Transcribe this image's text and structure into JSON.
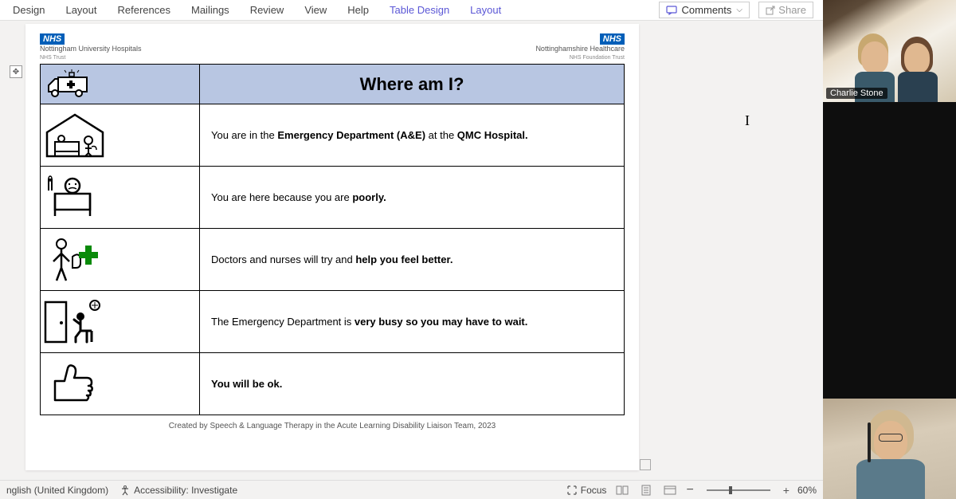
{
  "ribbon": {
    "tabs": [
      "Design",
      "Layout",
      "References",
      "Mailings",
      "Review",
      "View",
      "Help",
      "Table Design",
      "Layout"
    ],
    "active_indexes": [
      7,
      8
    ],
    "comments_label": "Comments",
    "share_label": "Share"
  },
  "doc": {
    "header_left_org": "Nottingham University Hospitals",
    "header_left_sub": "NHS Trust",
    "header_right_org": "Nottinghamshire Healthcare",
    "header_right_sub": "NHS Foundation Trust",
    "nhs_badge": "NHS",
    "title": "Where am I?",
    "rows": [
      {
        "segments": [
          {
            "t": "You are in the ",
            "b": false
          },
          {
            "t": "Emergency Department (A&E)",
            "b": true
          },
          {
            "t": " at the ",
            "b": false
          },
          {
            "t": "QMC Hospital.",
            "b": true
          }
        ]
      },
      {
        "segments": [
          {
            "t": "You are here because you are ",
            "b": false
          },
          {
            "t": "poorly.",
            "b": true
          }
        ]
      },
      {
        "segments": [
          {
            "t": "Doctors and nurses will try and ",
            "b": false
          },
          {
            "t": "help you feel better.",
            "b": true
          }
        ]
      },
      {
        "segments": [
          {
            "t": "The Emergency Department is ",
            "b": false
          },
          {
            "t": "very busy so you may have to wait.",
            "b": true
          }
        ]
      },
      {
        "segments": [
          {
            "t": "You will be ok.",
            "b": true
          }
        ]
      }
    ],
    "footer": "Created by Speech & Language Therapy in the Acute Learning Disability Liaison Team, 2023"
  },
  "status_bar": {
    "language": "nglish (United Kingdom)",
    "accessibility": "Accessibility: Investigate",
    "focus_label": "Focus",
    "zoom_pct": "60%"
  },
  "participants": {
    "top_name": "Charlie Stone"
  },
  "icons": {
    "ambulance": "ambulance-icon",
    "house_bed": "house-patient-icon",
    "sick_bed": "patient-bed-icon",
    "doctor": "person-plus-icon",
    "waiting": "waiting-room-icon",
    "thumbs_up": "thumbs-up-icon"
  }
}
